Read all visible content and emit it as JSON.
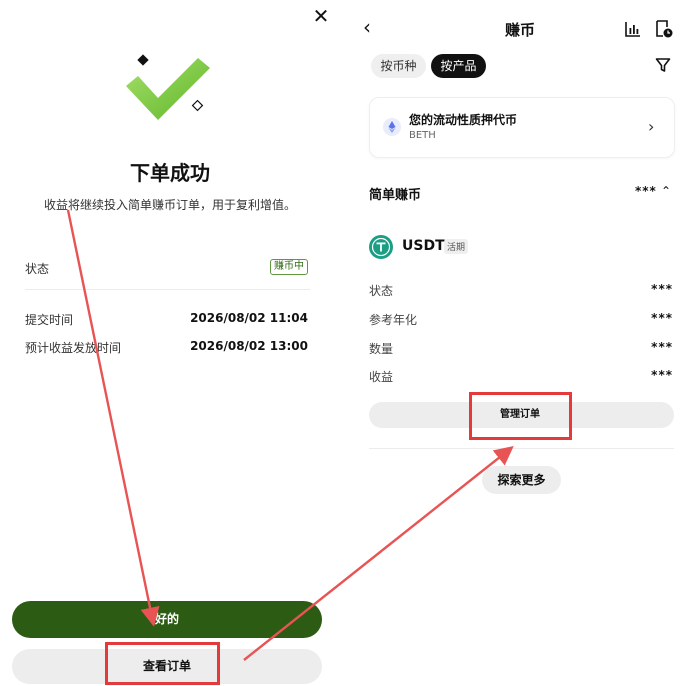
{
  "left": {
    "title": "下单成功",
    "subtitle": "收益将继续投入简单赚币订单，用于复利增值。",
    "status_label": "状态",
    "status_badge": "赚币中",
    "submit_time_label": "提交时间",
    "submit_time_value": "2026/08/02 11:04",
    "payout_label": "预计收益发放时间",
    "payout_value": "2026/08/02 13:00",
    "ok_button": "好的",
    "view_order_button": "查看订单"
  },
  "right": {
    "nav_title": "赚币",
    "chip_by_coin": "按币种",
    "chip_by_product": "按产品",
    "card_title": "您的流动性质押代币",
    "card_subtitle": "BETH",
    "section_title": "简单赚币",
    "section_masked": "***",
    "coin_name": "USDT",
    "coin_tag": "活期",
    "rows": [
      {
        "label": "状态",
        "value": "***"
      },
      {
        "label": "参考年化",
        "value": "***"
      },
      {
        "label": "数量",
        "value": "***"
      },
      {
        "label": "收益",
        "value": "***"
      }
    ],
    "manage_button": "管理订单",
    "explore_button": "探索更多"
  },
  "colors": {
    "primary_green": "#2c5b13",
    "annotation_red": "#e33b3b",
    "check_green": "#7fcc3c",
    "usdt_teal": "#1a9e84"
  }
}
